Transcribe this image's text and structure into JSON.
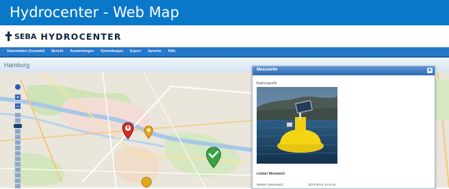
{
  "slide_title": "Hydrocenter - Web Map",
  "header": {
    "brand": "SEBA",
    "product": "HYDROCENTER"
  },
  "nav": {
    "items": [
      "Stammdaten (Auswahl)",
      "Bericht",
      "Auswertungen",
      "Einstellungen",
      "Export",
      "Sprache",
      "Hilfe"
    ]
  },
  "map_panel": {
    "title": "Hamburg"
  },
  "map": {
    "zoom_in": "+",
    "zoom_out": "−"
  },
  "markers": [
    {
      "name": "marker-red",
      "color": "#c8312b"
    },
    {
      "name": "marker-yellow",
      "color": "#e5a91d"
    },
    {
      "name": "marker-green",
      "color": "#3aa347"
    },
    {
      "name": "marker-yellow-bottom",
      "color": "#e5a91d"
    }
  ],
  "detail": {
    "title": "Messstelle",
    "photo_label": "Stationsgrafik",
    "last_label": "Letzter Messwert:",
    "row_label": "Wasser (Messwert)",
    "row_value": "2013-09-xx 14:xx:xx"
  },
  "colors": {
    "title_bar": "#0a78c8",
    "nav": "#2678c9",
    "detail_header": "#2e68b0"
  }
}
